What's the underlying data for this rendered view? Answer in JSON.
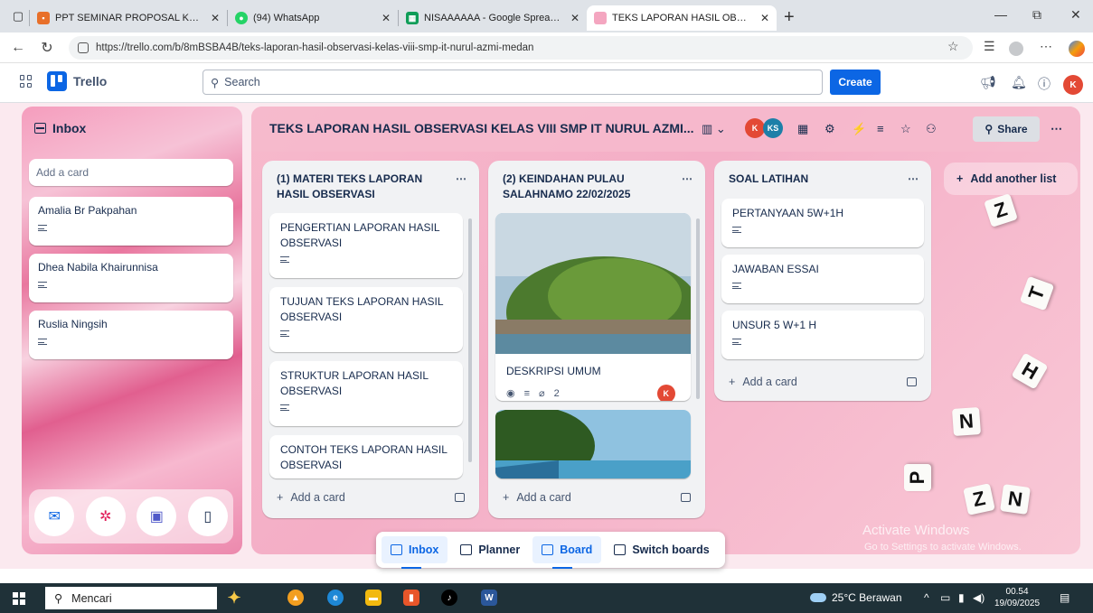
{
  "browser": {
    "tabs": [
      {
        "title": "PPT SEMINAR PROPOSAL KHAIRU",
        "icon": "slides-icon",
        "color": "#e8702a"
      },
      {
        "title": "(94) WhatsApp",
        "icon": "whatsapp-icon",
        "color": "#25d366"
      },
      {
        "title": "NISAAAAAA - Google Spreadshe",
        "icon": "sheets-icon",
        "color": "#0f9d58"
      },
      {
        "title": "TEKS LAPORAN HASIL OBSERVAS",
        "icon": "trello-icon",
        "color": "#f4a6c0",
        "active": true
      }
    ],
    "url": "https://trello.com/b/8mBSBA4B/teks-laporan-hasil-observasi-kelas-viii-smp-it-nurul-azmi-medan"
  },
  "header": {
    "logo": "Trello",
    "search_placeholder": "Search",
    "create_label": "Create",
    "avatar_initial": "K"
  },
  "inbox": {
    "title": "Inbox",
    "add_placeholder": "Add a card",
    "cards": [
      {
        "title": "Amalia Br Pakpahan"
      },
      {
        "title": "Dhea Nabila Khairunnisa"
      },
      {
        "title": "Ruslia Ningsih"
      }
    ]
  },
  "board": {
    "title": "TEKS LAPORAN HASIL OBSERVASI KELAS VIII SMP IT NURUL AZMI...",
    "share_label": "Share",
    "members": [
      "K",
      "KS"
    ],
    "add_list_label": "Add another list",
    "lists": [
      {
        "title": "(1) MATERI TEKS LAPORAN HASIL OBSERVASI",
        "cards": [
          "PENGERTIAN LAPORAN HASIL OBSERVASI",
          "TUJUAN TEKS LAPORAN HASIL OBSERVASI",
          "STRUKTUR LAPORAN HASIL OBSERVASI",
          "CONTOH TEKS LAPORAN HASIL OBSERVASI"
        ],
        "add_card": "Add a card"
      },
      {
        "title": "(2) KEINDAHAN PULAU SALAHNAMO 22/02/2025",
        "cards": [
          {
            "title": "DESKRIPSI UMUM",
            "attachments": "2",
            "member": "K"
          }
        ],
        "add_card": "Add a card"
      },
      {
        "title": "SOAL LATIHAN",
        "cards": [
          "PERTANYAAN 5W+1H",
          "JAWABAN ESSAI",
          "UNSUR 5 W+1 H"
        ],
        "add_card": "Add a card"
      }
    ],
    "letter_tiles": [
      "Z",
      "T",
      "H",
      "N",
      "N",
      "Z",
      "P"
    ]
  },
  "switcher": {
    "items": [
      "Inbox",
      "Planner",
      "Board",
      "Switch boards"
    ]
  },
  "watermark": {
    "line1": "Activate Windows",
    "line2": "Go to Settings to activate Windows."
  },
  "taskbar": {
    "search_label": "Mencari",
    "weather": "25°C  Berawan",
    "time": "00.54",
    "date": "19/09/2025"
  }
}
